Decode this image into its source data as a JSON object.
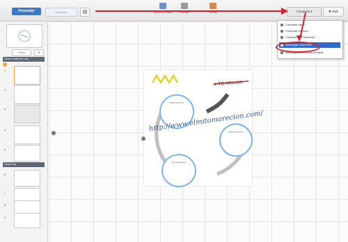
{
  "toolbar": {
    "present_label": "Presentar",
    "undo_label": "Deshacer",
    "save_icon": "save-icon",
    "tools": [
      {
        "label": "Marco y Rutas",
        "color": "#6b8fcf"
      },
      {
        "label": "Insertar",
        "color": "#9a9a9a"
      },
      {
        "label": "Temas",
        "color": "#d58a4a"
      }
    ],
    "share_label": "Compartir ▾",
    "exit_label": "✖ Salir"
  },
  "share_menu": {
    "items": [
      {
        "label": "Compartir prezi..."
      },
      {
        "label": "Presentar en línea"
      },
      {
        "label": "Compartir en Facebook..."
      },
      {
        "label": "Descargar como PDF"
      },
      {
        "label": "Descargar como prezi portable"
      }
    ],
    "active_index": 3
  },
  "sidebar": {
    "edit_path_label": "Editar",
    "path_header_1": "Crear Camino de ruta",
    "path_header_2": "Grupo Nav",
    "thumb_numbers": [
      "1",
      "2",
      "3",
      "4",
      "5",
      "6",
      "7",
      "8",
      "9"
    ]
  },
  "canvas": {
    "url_text": "http://www.elmitomarecion.com/",
    "logo_text": "e-TO-Micción",
    "circle_titles": [
      "Nuevo del Proz",
      "Nuevo de texto",
      "Presentaciones"
    ]
  },
  "colors": {
    "accent": "#3a79c8",
    "annotation_red": "#d6202a",
    "menu_highlight": "#2f6cc7",
    "circle_stroke": "#7cb3e8"
  }
}
